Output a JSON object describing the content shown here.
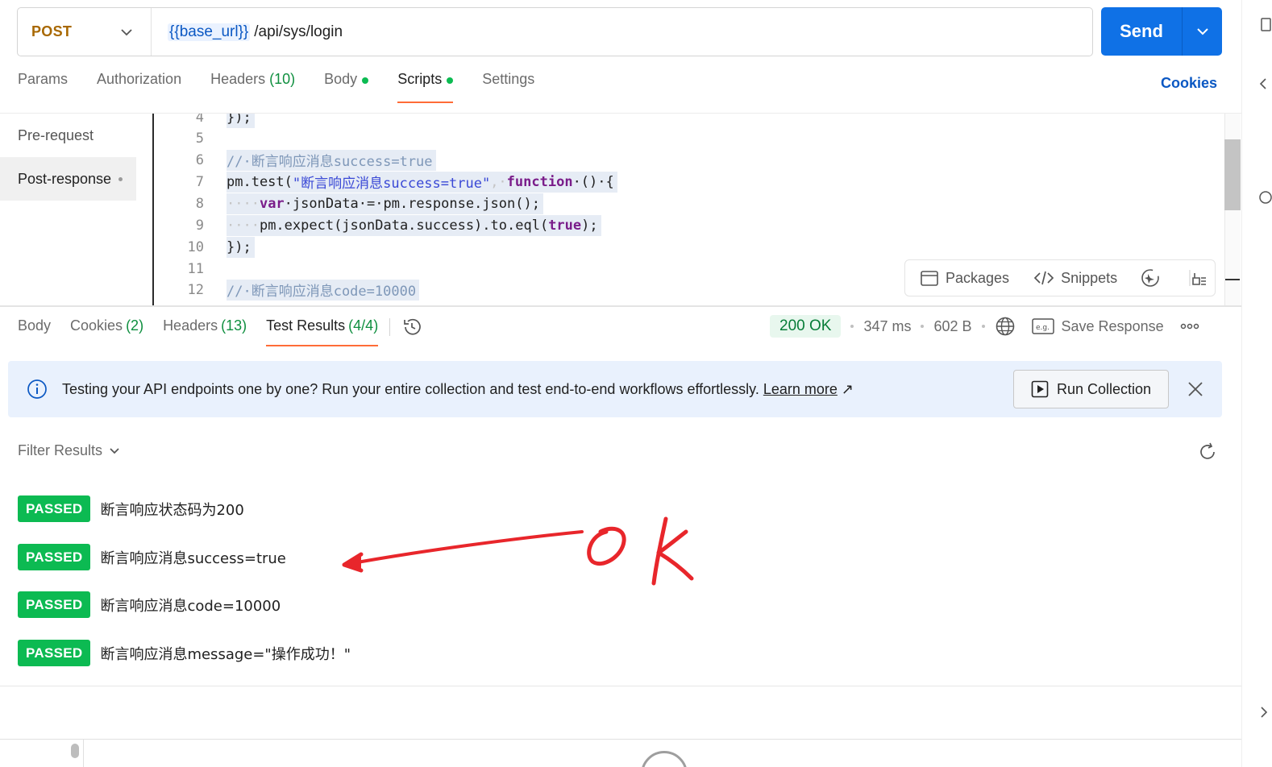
{
  "request": {
    "method": "POST",
    "url_variable": "{{base_url}}",
    "url_path": "/api/sys/login",
    "send_label": "Send"
  },
  "request_tabs": [
    {
      "label": "Params",
      "count": ""
    },
    {
      "label": "Authorization",
      "count": ""
    },
    {
      "label": "Headers",
      "count": "(10)"
    },
    {
      "label": "Body",
      "count": ""
    },
    {
      "label": "Scripts",
      "count": ""
    },
    {
      "label": "Settings",
      "count": ""
    }
  ],
  "active_request_tab": "Scripts",
  "cookies_label": "Cookies",
  "script_nav": {
    "pre_request": "Pre-request",
    "post_response": "Post-response"
  },
  "editor": {
    "line_numbers": [
      "4",
      "5",
      "6",
      "7",
      "8",
      "9",
      "10",
      "11",
      "12"
    ],
    "line4": "});",
    "line6": "//·断言响应消息success=true",
    "line7_a": "pm.test(",
    "line7_str": "\"断言响应消息success=true\"",
    "line7_b": ",·",
    "line7_kw": "function",
    "line7_c": "·()·{",
    "line8_ws": "····",
    "line8_kw": "var",
    "line8_rest": "·jsonData·=·pm.response.json();",
    "line9_ws": "····",
    "line9_a": "pm.expect(jsonData.success).to.eql(",
    "line9_kw": "true",
    "line9_b": ");",
    "line10": "});",
    "line12": "//·断言响应消息code=10000"
  },
  "editor_tools": {
    "packages": "Packages",
    "snippets": "Snippets"
  },
  "response_tabs": [
    {
      "label": "Body",
      "count": ""
    },
    {
      "label": "Cookies",
      "count": "(2)"
    },
    {
      "label": "Headers",
      "count": "(13)"
    },
    {
      "label": "Test Results",
      "count": "(4/4)"
    }
  ],
  "active_response_tab": "Test Results",
  "response_status": {
    "status": "200 OK",
    "time": "347 ms",
    "size": "602 B",
    "save_label": "Save Response"
  },
  "banner": {
    "text": "Testing your API endpoints one by one? Run your entire collection and test end-to-end workflows effortlessly.",
    "link": "Learn more",
    "link_arrow": "↗",
    "run_button": "Run Collection"
  },
  "filter_label": "Filter Results",
  "results": [
    {
      "status": "PASSED",
      "name": "断言响应状态码为200"
    },
    {
      "status": "PASSED",
      "name": "断言响应消息success=true"
    },
    {
      "status": "PASSED",
      "name": "断言响应消息code=10000"
    },
    {
      "status": "PASSED",
      "name": "断言响应消息message=\"操作成功！\""
    }
  ],
  "annotation": {
    "text": "ok",
    "color": "#e8262b"
  },
  "colors": {
    "accent_blue": "#0f71e6",
    "passed_green": "#0cba52",
    "method_orange": "#a86800",
    "tab_underline": "#ff6c37"
  }
}
